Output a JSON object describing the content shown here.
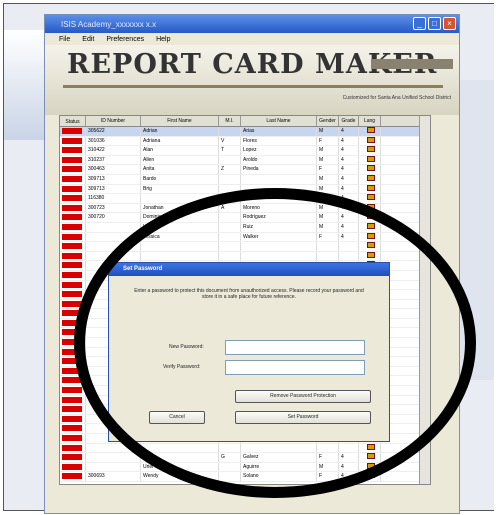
{
  "window": {
    "title": "ISIS Academy_xxxxxxx x.x",
    "menu": [
      "File",
      "Edit",
      "Preferences",
      "Help"
    ]
  },
  "header": {
    "logo_text": "REPORT CARD MAKER",
    "version_badge": "",
    "customized_text": "Customized for Santa Ana Unified School District"
  },
  "table": {
    "columns": [
      "Status",
      "ID Number",
      "First Name",
      "M.I.",
      "Last Name",
      "Gender",
      "Grade",
      "Lang"
    ],
    "rows": [
      {
        "id": "305622",
        "first": "Adrian",
        "mi": "",
        "last": "Arias",
        "gender": "M",
        "grade": "4"
      },
      {
        "id": "301036",
        "first": "Adriana",
        "mi": "V",
        "last": "Flores",
        "gender": "F",
        "grade": "4"
      },
      {
        "id": "310422",
        "first": "Alan",
        "mi": "T",
        "last": "Lopez",
        "gender": "M",
        "grade": "4"
      },
      {
        "id": "310237",
        "first": "Allen",
        "mi": "",
        "last": "Aroldo",
        "gender": "M",
        "grade": "4"
      },
      {
        "id": "300463",
        "first": "Anita",
        "mi": "Z",
        "last": "Pineda",
        "gender": "F",
        "grade": "4"
      },
      {
        "id": "309713",
        "first": "Bardo",
        "mi": "",
        "last": "",
        "gender": "M",
        "grade": "4"
      },
      {
        "id": "309713",
        "first": "Brig",
        "mi": "",
        "last": "",
        "gender": "M",
        "grade": "4"
      },
      {
        "id": "116380",
        "first": "",
        "mi": "",
        "last": "Silva",
        "gender": "M",
        "grade": "4"
      },
      {
        "id": "300723",
        "first": "Jonathan",
        "mi": "A",
        "last": "Moreno",
        "gender": "M",
        "grade": "4"
      },
      {
        "id": "300720",
        "first": "Dominic",
        "mi": "",
        "last": "Rodriguez",
        "gender": "M",
        "grade": "4"
      },
      {
        "id": "",
        "first": "Hilaria",
        "mi": "",
        "last": "Ruiz",
        "gender": "M",
        "grade": "4"
      },
      {
        "id": "",
        "first": "Jessica",
        "mi": "",
        "last": "Walker",
        "gender": "F",
        "grade": "4"
      }
    ],
    "bottom_rows": [
      {
        "id": "",
        "first": "Sofia",
        "mi": "G",
        "last": "Galvez",
        "gender": "F",
        "grade": "4"
      },
      {
        "id": "",
        "first": "Uriel",
        "mi": "",
        "last": "Aguirre",
        "gender": "M",
        "grade": "4"
      },
      {
        "id": "300693",
        "first": "Wendy",
        "mi": "",
        "last": "Solano",
        "gender": "F",
        "grade": "4"
      }
    ]
  },
  "dialog": {
    "title": "Set Password",
    "message": "Enter a password to protect this document from unauthorized access. Please record your password and store it in a safe place for future reference.",
    "new_password_label": "New Password:",
    "verify_password_label": "Verify Password:",
    "remove_button": "Remove Password Protection",
    "cancel_button": "Cancel",
    "set_button": "Set Password"
  },
  "colors": {
    "status_red": "#d80000",
    "focus_circle": "#000000",
    "dialog_title_blue": "#2559c7"
  }
}
